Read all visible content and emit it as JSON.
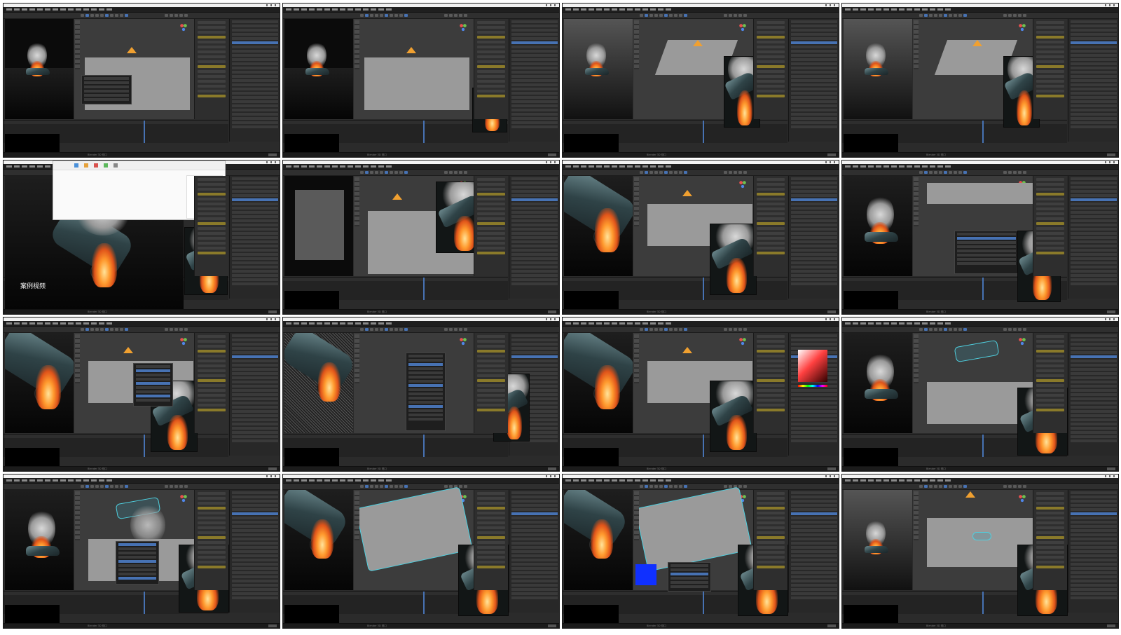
{
  "tiles": [
    {
      "id": 1,
      "scene": "car-on-floor-fire",
      "status": "Blender 3D 视口"
    },
    {
      "id": 2,
      "scene": "car-fire-plane",
      "status": "Blender 3D 视口"
    },
    {
      "id": 3,
      "scene": "car-grey-plane-render",
      "status": "Blender 3D 视口"
    },
    {
      "id": 4,
      "scene": "car-grey-plane-render",
      "status": "Blender 3D 视口"
    },
    {
      "id": 5,
      "scene": "video-preview",
      "caption": "案例视频",
      "status": "Blender 3D 视口"
    },
    {
      "id": 6,
      "scene": "camera-setup",
      "status": "Blender 3D 视口"
    },
    {
      "id": 7,
      "scene": "car-closeup-camera",
      "status": "Blender 3D 视口"
    },
    {
      "id": 8,
      "scene": "material-menu",
      "status": "Blender 3D 视口"
    },
    {
      "id": 9,
      "scene": "car-closeup-sparks",
      "status": "Blender 3D 视口"
    },
    {
      "id": 10,
      "scene": "noise-particles",
      "status": "Blender 3D 视口"
    },
    {
      "id": 11,
      "scene": "color-picker",
      "status": "Blender 3D 视口"
    },
    {
      "id": 12,
      "scene": "wireframe-car",
      "status": "Blender 3D 视口"
    },
    {
      "id": 13,
      "scene": "wireframe-car-smoke",
      "status": "Blender 3D 视口"
    },
    {
      "id": 14,
      "scene": "car-mesh-edit",
      "status": "Blender 3D 视口"
    },
    {
      "id": 15,
      "scene": "car-mesh-blue",
      "status": "Blender 3D 视口"
    },
    {
      "id": 16,
      "scene": "camera-rig",
      "status": "Blender 3D 视口"
    }
  ],
  "colors": {
    "blender_bg": "#2b2b2b",
    "viewport": "#3c3c3c",
    "accent_blue": "#4772b3",
    "camera_orange": "#f0a030",
    "wire_cyan": "#4fd0e0",
    "fire": "#ff9a2e"
  },
  "icons": [
    "gizmo-icon",
    "camera-icon",
    "window-controls-icon"
  ]
}
